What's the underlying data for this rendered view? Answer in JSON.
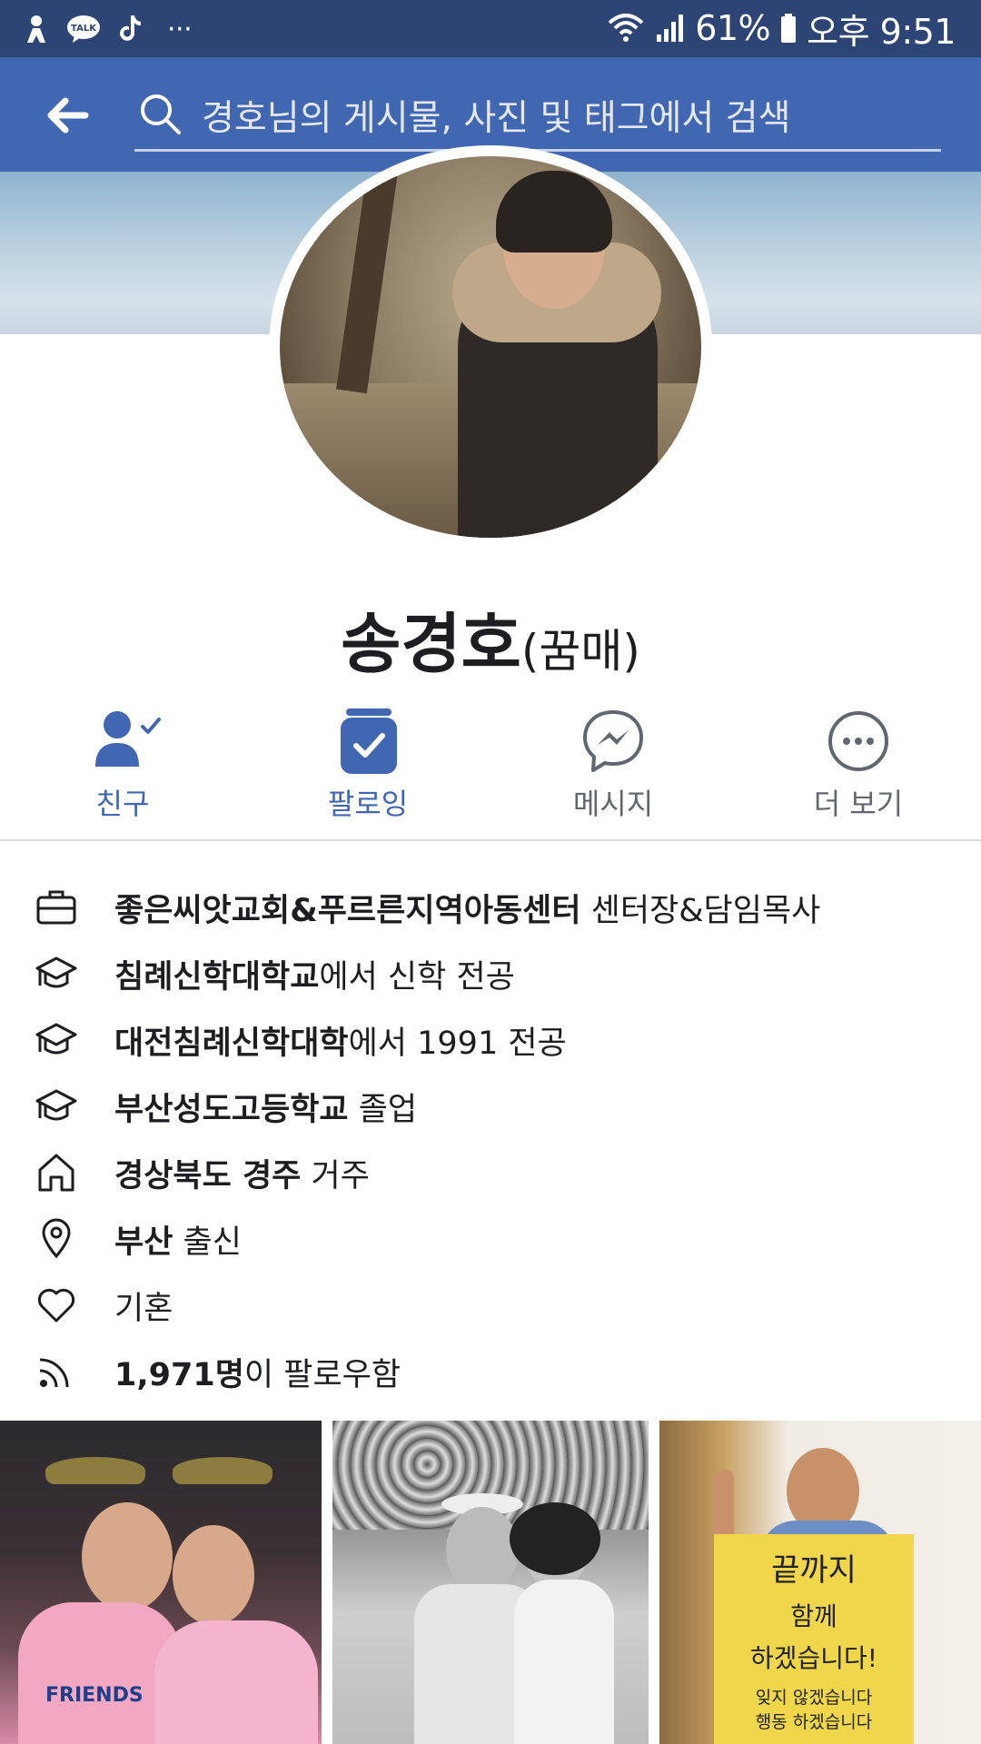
{
  "status_bar": {
    "battery": "61%",
    "time": "오후 9:51",
    "more": "···",
    "notification_icons": [
      "kakao-story-icon",
      "kakaotalk-icon",
      "tiktok-icon"
    ]
  },
  "search": {
    "placeholder": "경호님의 게시물, 사진 및 태그에서 검색"
  },
  "profile": {
    "name": "송경호",
    "alternate_name": "(꿈매)"
  },
  "actions": [
    {
      "label": "친구",
      "icon": "friend-check-icon",
      "active": true
    },
    {
      "label": "팔로잉",
      "icon": "following-check-icon",
      "active": true
    },
    {
      "label": "메시지",
      "icon": "messenger-icon",
      "active": false
    },
    {
      "label": "더 보기",
      "icon": "more-dots-icon",
      "active": false
    }
  ],
  "intro": [
    {
      "icon": "briefcase-icon",
      "bold": "좋은씨앗교회&푸르른지역아동센터",
      "text": " 센터장&담임목사"
    },
    {
      "icon": "graduation-cap-icon",
      "bold": "침례신학대학교",
      "text": "에서 신학 전공"
    },
    {
      "icon": "graduation-cap-icon",
      "bold": "대전침례신학대학",
      "text": "에서 1991 전공"
    },
    {
      "icon": "graduation-cap-icon",
      "bold": "부산성도고등학교",
      "text": " 졸업"
    },
    {
      "icon": "home-icon",
      "bold": "경상북도 경주",
      "text": " 거주"
    },
    {
      "icon": "location-pin-icon",
      "bold": "부산",
      "text": " 출신"
    },
    {
      "icon": "heart-icon",
      "bold": "",
      "text": "기혼"
    },
    {
      "icon": "rss-followers-icon",
      "bold": "1,971명",
      "text": "이 팔로우함"
    }
  ],
  "photo_sign_text": [
    "끝까지",
    "함께",
    "하겠습니다!",
    "잊지 않겠습니다",
    "행동 하겠습니다"
  ],
  "photo_sweatshirt_text": "FRIENDS",
  "colors": {
    "status_bar": "#2d4575",
    "header": "#4267b2",
    "accent": "#4267b2",
    "secondary_text": "#606770"
  }
}
